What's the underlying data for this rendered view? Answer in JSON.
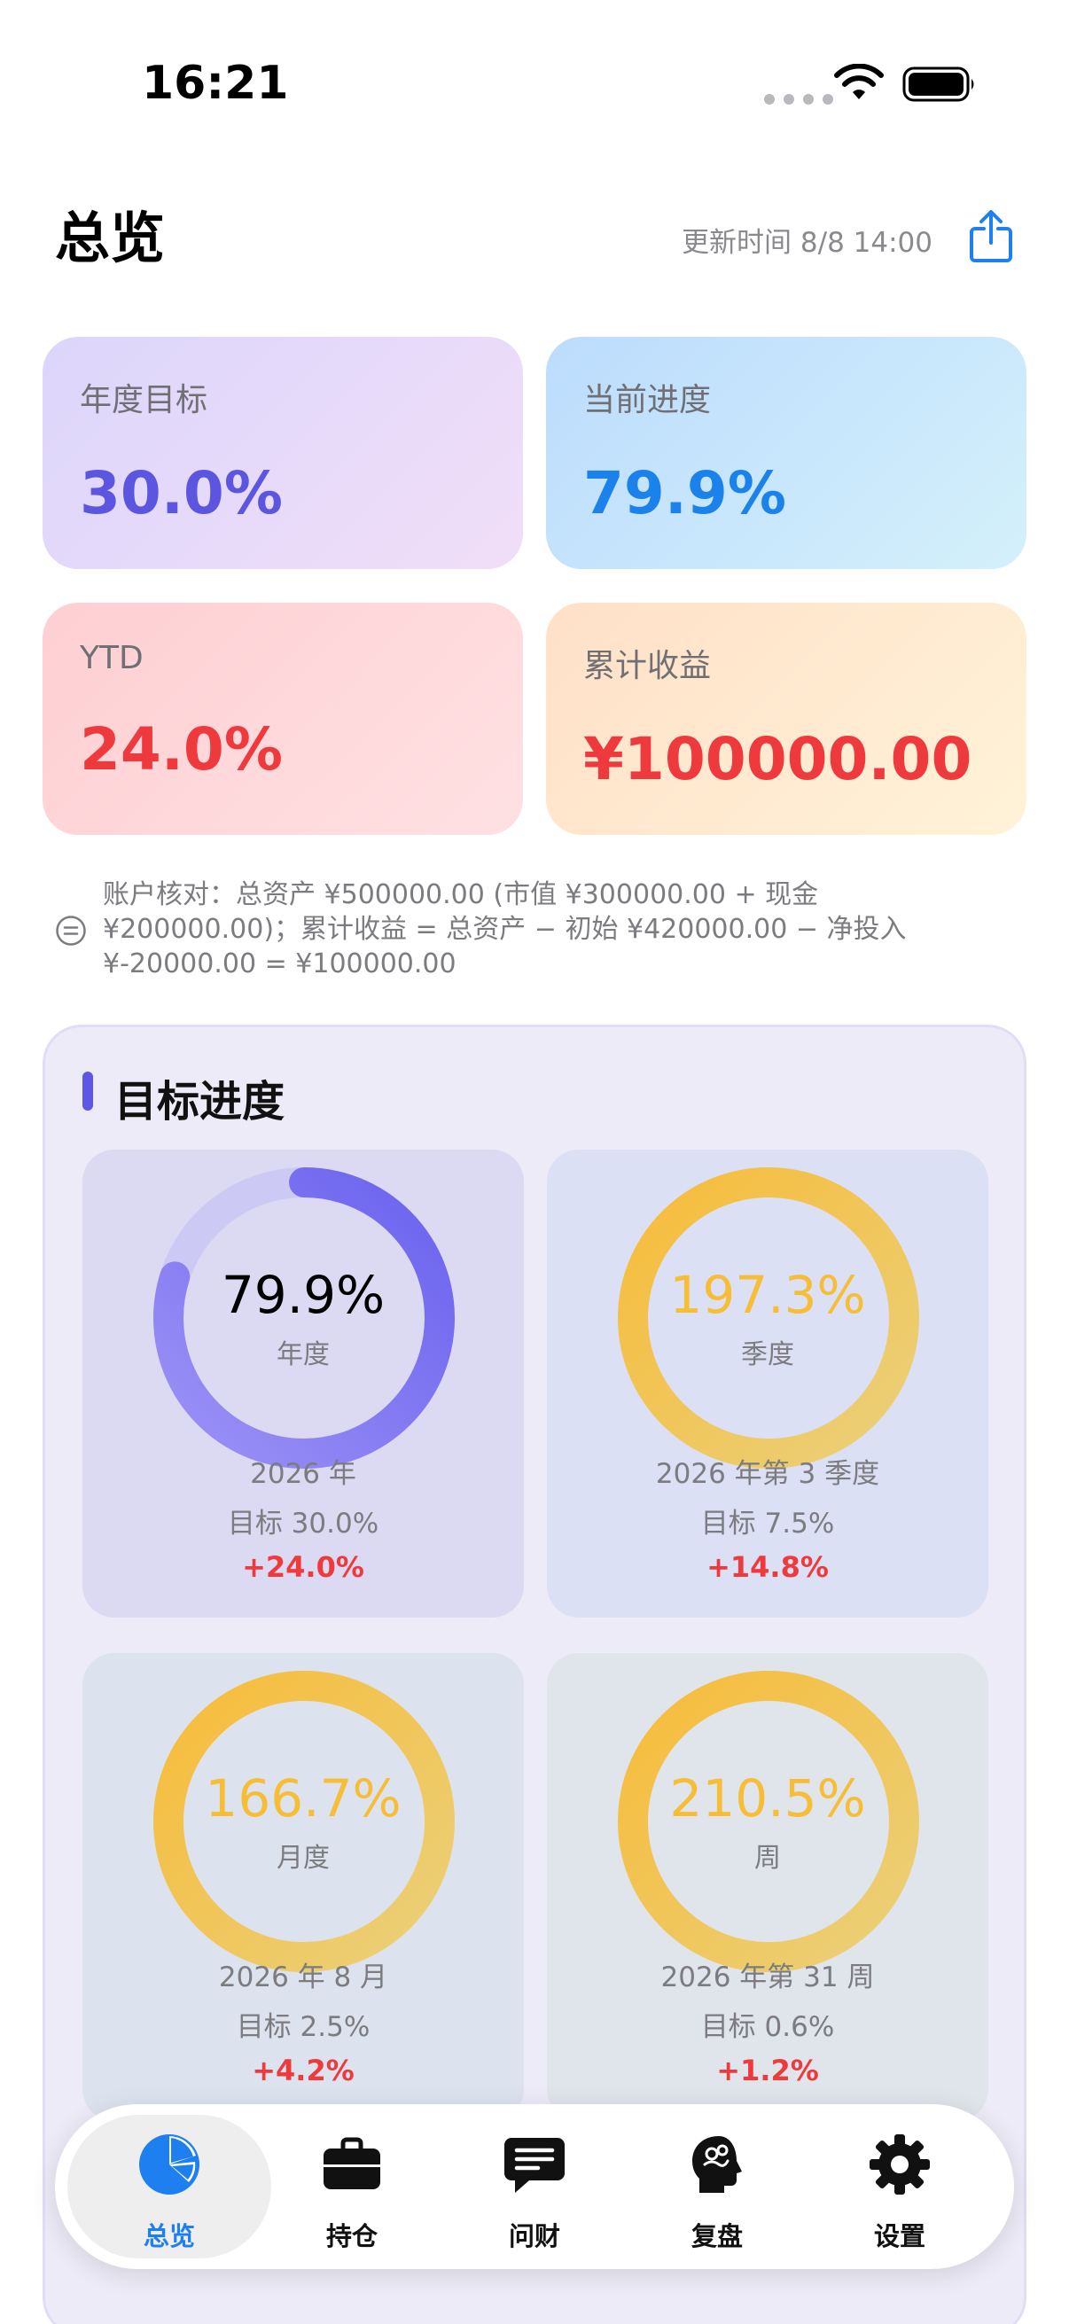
{
  "status_bar": {
    "time": "16:21"
  },
  "header": {
    "title": "总览",
    "update_time": "更新时间 8/8 14:00"
  },
  "cards": [
    {
      "label": "年度目标",
      "value": "30.0%"
    },
    {
      "label": "当前进度",
      "value": "79.9%"
    },
    {
      "label": "YTD",
      "value": "24.0%"
    },
    {
      "label": "累计收益",
      "value": "¥100000.00"
    }
  ],
  "note": "账户核对：总资产 ¥500000.00 (市值 ¥300000.00 + 现金 ¥200000.00)；累计收益 = 总资产 − 初始 ¥420000.00 − 净投入 ¥-20000.00 = ¥100000.00",
  "goal": {
    "title": "目标进度",
    "rings": [
      {
        "pct": "79.9%",
        "period": "年度",
        "line1": "2026 年",
        "line2": "目标 30.0%",
        "line3": "+24.0%",
        "fill": 0.799
      },
      {
        "pct": "197.3%",
        "period": "季度",
        "line1": "2026 年第 3 季度",
        "line2": "目标 7.5%",
        "line3": "+14.8%",
        "fill": 1.0
      },
      {
        "pct": "166.7%",
        "period": "月度",
        "line1": "2026 年 8 月",
        "line2": "目标 2.5%",
        "line3": "+4.2%",
        "fill": 1.0
      },
      {
        "pct": "210.5%",
        "period": "周",
        "line1": "2026 年第 31 周",
        "line2": "目标 0.6%",
        "line3": "+1.2%",
        "fill": 1.0
      }
    ]
  },
  "tabs": [
    {
      "label": "总览",
      "icon": "pie-chart-icon",
      "active": true
    },
    {
      "label": "持仓",
      "icon": "briefcase-icon",
      "active": false
    },
    {
      "label": "问财",
      "icon": "chat-bubble-icon",
      "active": false
    },
    {
      "label": "复盘",
      "icon": "brain-head-icon",
      "active": false
    },
    {
      "label": "设置",
      "icon": "gear-icon",
      "active": false
    }
  ],
  "colors": {
    "accent_blue": "#1d7ff0",
    "purple": "#5b55e0",
    "red": "#ef3a3d",
    "gold": "#f6bd35"
  }
}
